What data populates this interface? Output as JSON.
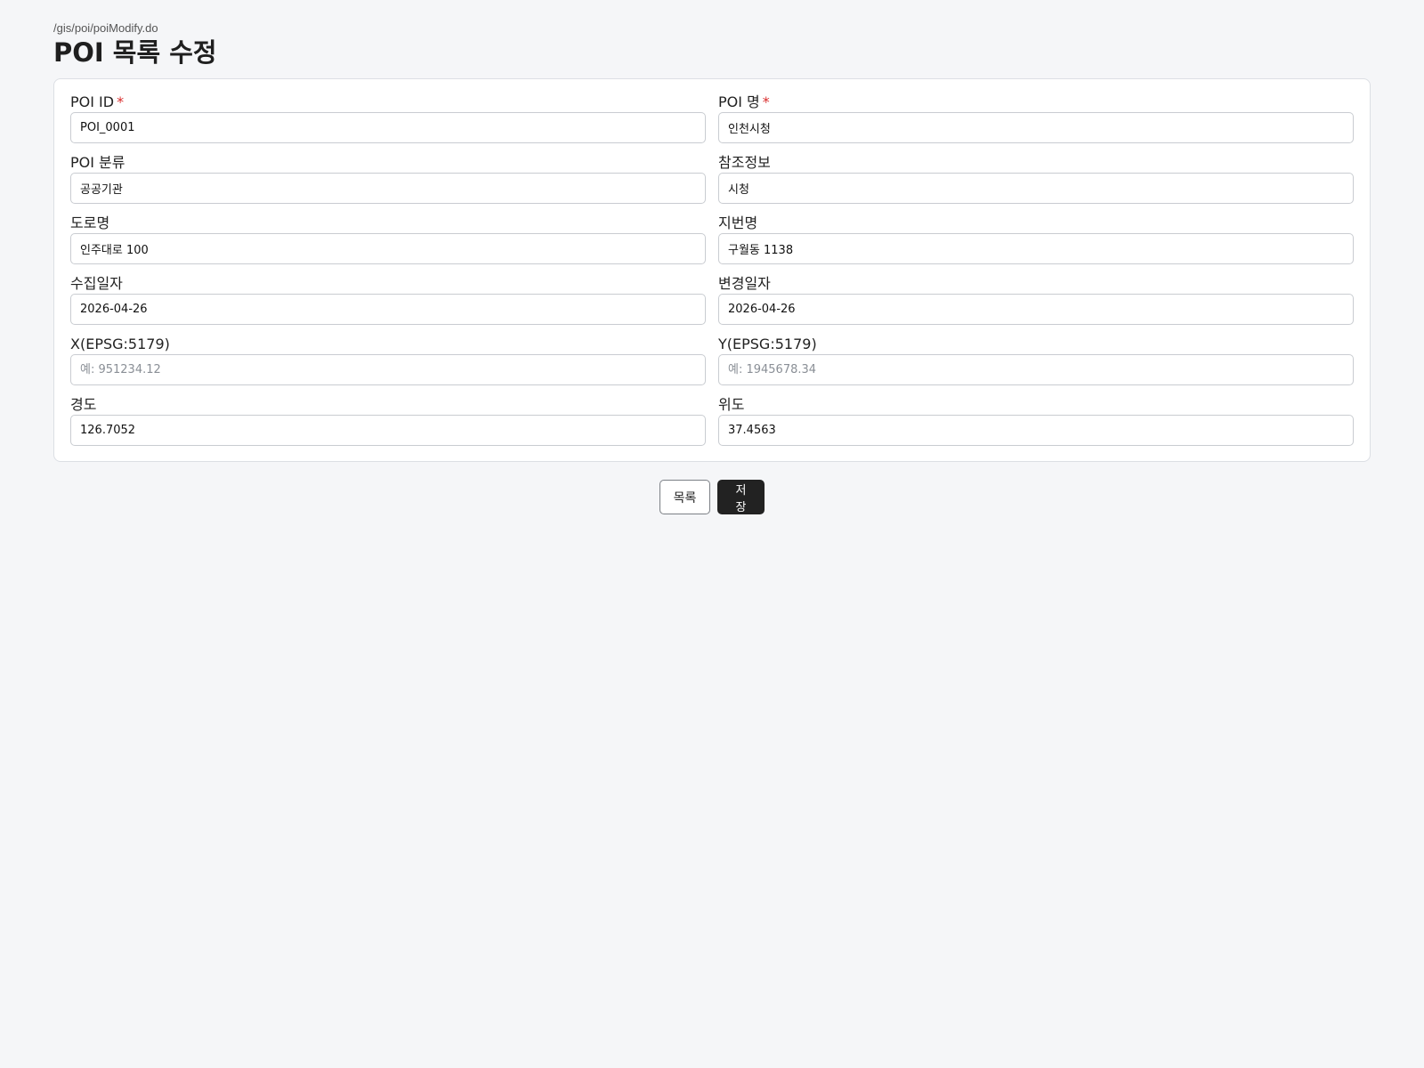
{
  "header": {
    "path": "/gis/poi/poiModify.do",
    "title": "POI 목록 수정"
  },
  "form": {
    "required_mark": "*",
    "fields": {
      "poi_id": {
        "label": "POI ID",
        "value": "POI_0001",
        "placeholder": ""
      },
      "poi_name": {
        "label": "POI 명",
        "value": "인천시청",
        "placeholder": ""
      },
      "poi_category": {
        "label": "POI 분류",
        "value": "공공기관",
        "placeholder": ""
      },
      "reference": {
        "label": "참조정보",
        "value": "시청",
        "placeholder": ""
      },
      "road_name": {
        "label": "도로명",
        "value": "인주대로 100",
        "placeholder": ""
      },
      "lot_name": {
        "label": "지번명",
        "value": "구월동 1138",
        "placeholder": ""
      },
      "collect_date": {
        "label": "수집일자",
        "value": "2026-04-26",
        "placeholder": ""
      },
      "modify_date": {
        "label": "변경일자",
        "value": "2026-04-26",
        "placeholder": ""
      },
      "x_coord": {
        "label": "X(EPSG:5179)",
        "value": "",
        "placeholder": "예: 951234.12"
      },
      "y_coord": {
        "label": "Y(EPSG:5179)",
        "value": "",
        "placeholder": "예: 1945678.34"
      },
      "longitude": {
        "label": "경도",
        "value": "126.7052",
        "placeholder": ""
      },
      "latitude": {
        "label": "위도",
        "value": "37.4563",
        "placeholder": ""
      }
    }
  },
  "actions": {
    "list_label": "목록",
    "save_label": "저장"
  },
  "colors": {
    "background": "#f5f6f8",
    "required": "#d92c2c",
    "save_button": "#222222"
  }
}
